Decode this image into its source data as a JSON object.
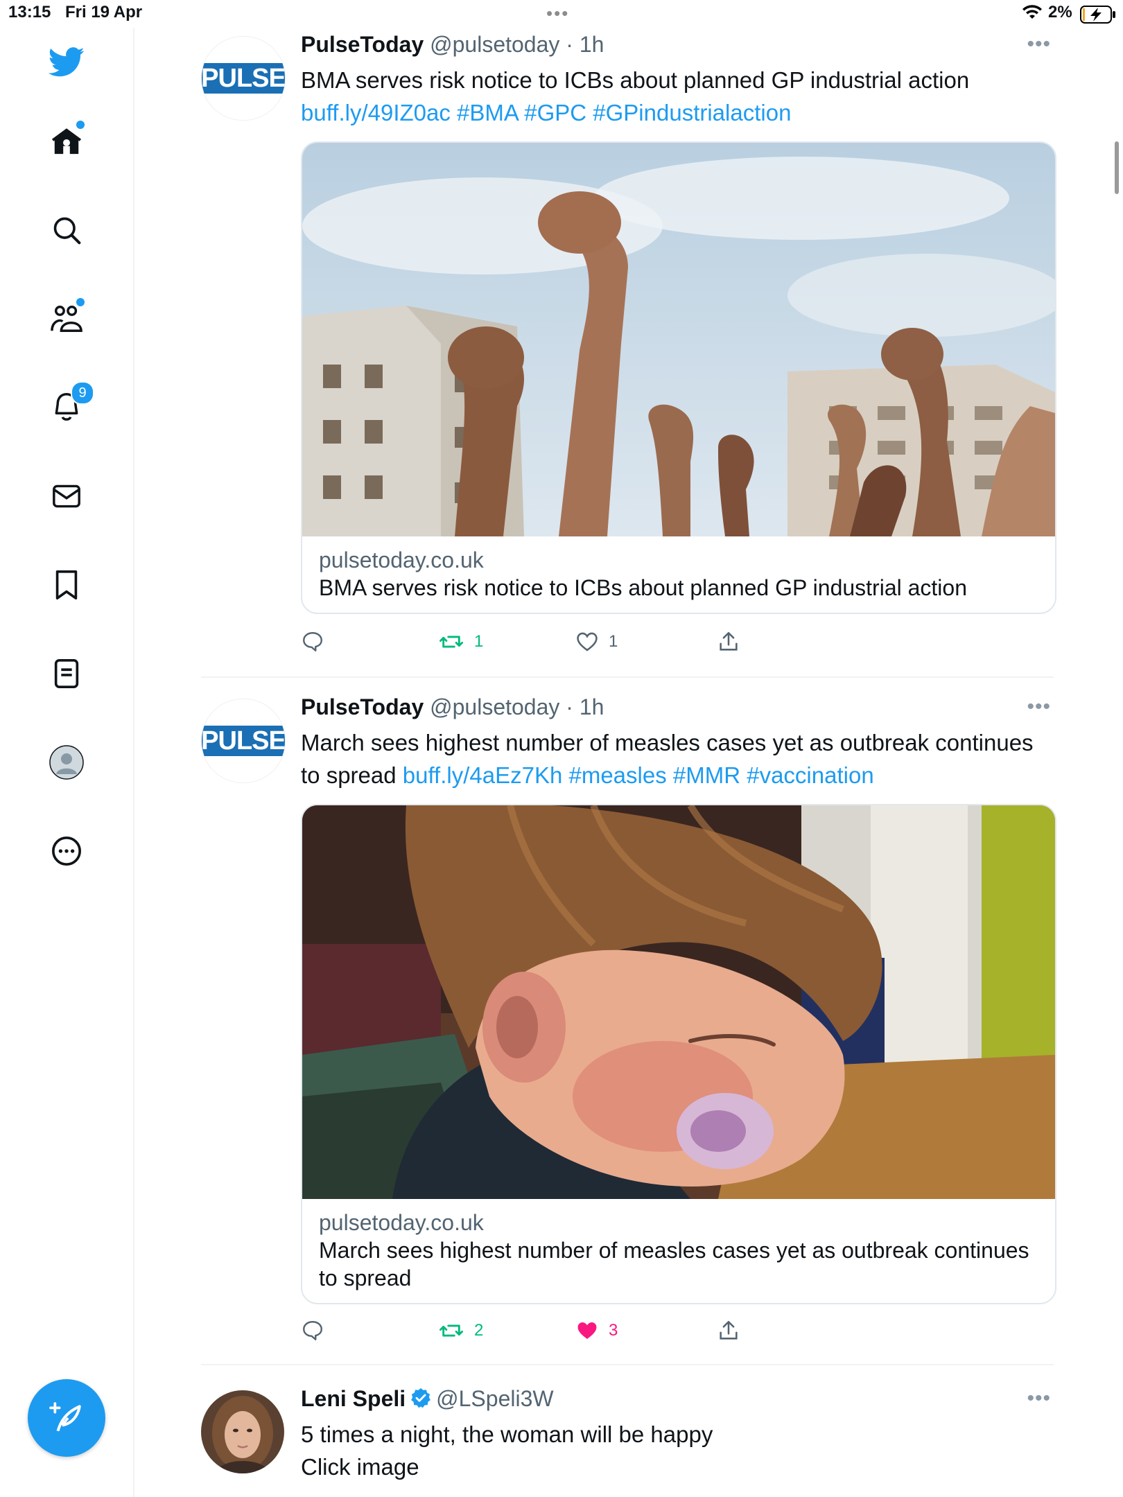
{
  "status_bar": {
    "time": "13:15",
    "date": "Fri 19 Apr",
    "battery_pct": "2%",
    "dots": "•••"
  },
  "sidebar": {
    "items": [
      {
        "name": "home",
        "icon": "home-icon",
        "has_dot": true
      },
      {
        "name": "explore",
        "icon": "search-icon"
      },
      {
        "name": "communities",
        "icon": "people-icon",
        "has_dot": true
      },
      {
        "name": "notifications",
        "icon": "bell-icon",
        "badge": "9"
      },
      {
        "name": "messages",
        "icon": "mail-icon"
      },
      {
        "name": "bookmarks",
        "icon": "bookmark-icon"
      },
      {
        "name": "lists",
        "icon": "list-icon"
      },
      {
        "name": "profile",
        "icon": "avatar-icon"
      },
      {
        "name": "more",
        "icon": "more-circle-icon"
      }
    ]
  },
  "colors": {
    "accent": "#1d9bf0",
    "retweet": "#00ba7c",
    "like": "#f91880",
    "muted": "#536471"
  },
  "tweets": [
    {
      "name": "PulseToday",
      "handle": "@pulsetoday",
      "sep": " · ",
      "time": "1h",
      "avatar_logo": "PULSE",
      "text_plain": "BMA serves risk notice to ICBs about planned GP industrial action",
      "text_links": "buff.ly/49IZ0ac #BMA #GPC #GPindustrialaction",
      "card_domain": "pulsetoday.co.uk",
      "card_title": "BMA serves risk notice to ICBs about planned GP industrial action",
      "retweets": "1",
      "likes": "1",
      "liked": false
    },
    {
      "name": "PulseToday",
      "handle": "@pulsetoday",
      "sep": " · ",
      "time": "1h",
      "avatar_logo": "PULSE",
      "text_plain": "March sees highest number of measles cases yet as outbreak continues to spread",
      "text_links": "buff.ly/4aEz7Kh #measles #MMR #vaccination",
      "card_domain": "pulsetoday.co.uk",
      "card_title": "March sees highest number of measles cases yet as outbreak continues to spread",
      "retweets": "2",
      "likes": "3",
      "liked": true
    },
    {
      "name": "Leni Speli",
      "handle": "@LSpeli3W",
      "verified": true,
      "text_line1": "5 times a night, the woman will be happy",
      "text_line2": "Click image"
    }
  ]
}
